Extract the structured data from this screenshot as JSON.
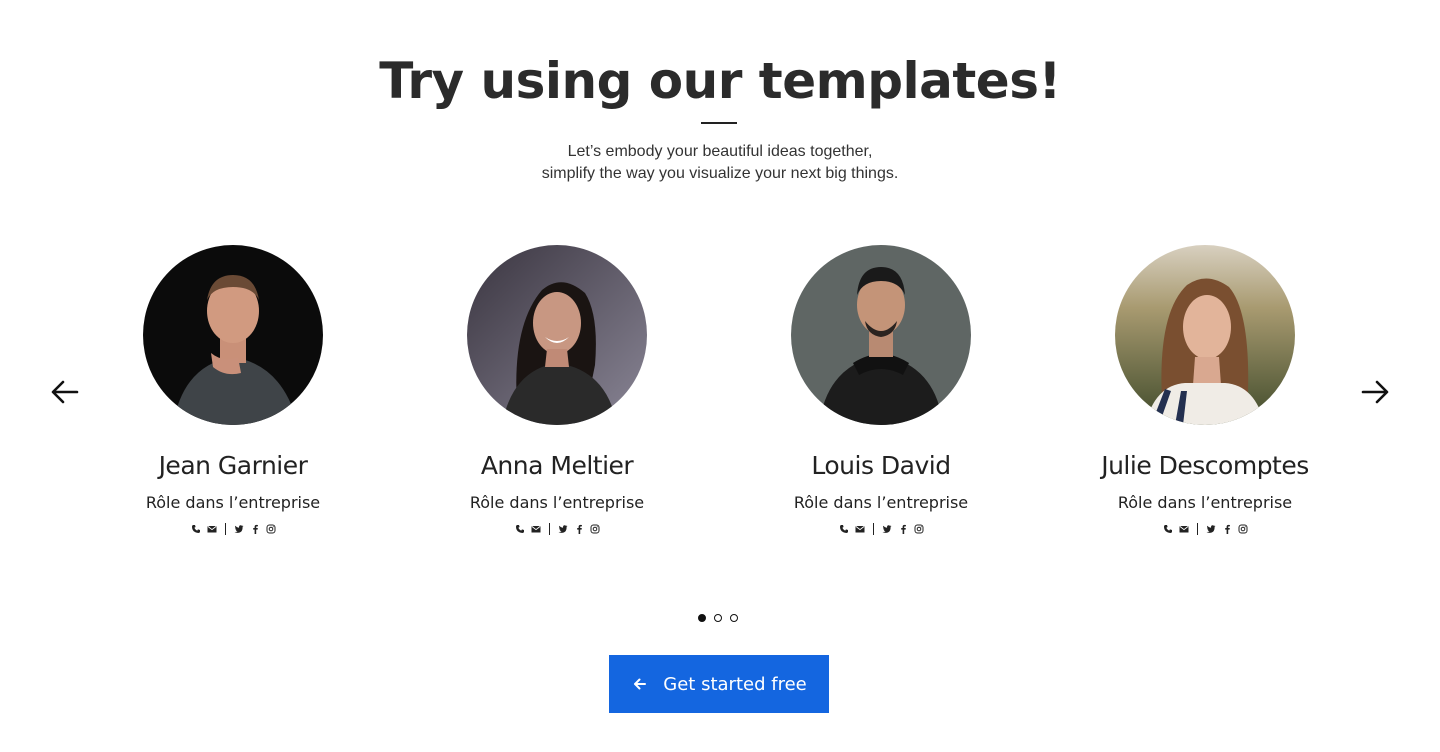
{
  "header": {
    "title": "Try using our templates!",
    "subtitle_line1": "Let’s embody your beautiful ideas together,",
    "subtitle_line2": "simplify the way you visualize your next big things."
  },
  "team": [
    {
      "name": "Jean Garnier",
      "role": "Rôle dans l’entreprise"
    },
    {
      "name": "Anna Meltier",
      "role": "Rôle dans l’entreprise"
    },
    {
      "name": "Louis David",
      "role": "Rôle dans l’entreprise"
    },
    {
      "name": "Julie Descomptes",
      "role": "Rôle dans l’entreprise"
    }
  ],
  "social_icons": [
    "phone-icon",
    "mail-icon",
    "twitter-icon",
    "facebook-icon",
    "instagram-icon"
  ],
  "carousel": {
    "pages": 3,
    "active_page": 1
  },
  "cta": {
    "label": "Get started free"
  },
  "colors": {
    "accent": "#1466e0",
    "text": "#222222"
  }
}
